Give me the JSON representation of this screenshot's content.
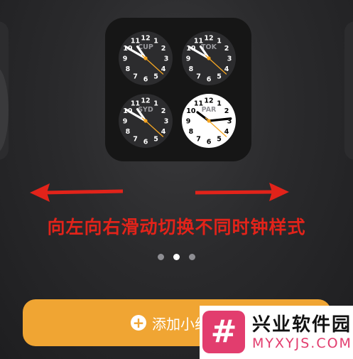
{
  "clocks": [
    {
      "city": "CUP",
      "theme": "dark",
      "hour": 10,
      "minute": 50,
      "second": 22
    },
    {
      "city": "TOK",
      "theme": "dark",
      "hour": 10,
      "minute": 50,
      "second": 22
    },
    {
      "city": "SYD",
      "theme": "dark",
      "hour": 10,
      "minute": 50,
      "second": 22
    },
    {
      "city": "PAR",
      "theme": "light",
      "hour": 10,
      "minute": 14,
      "second": 22
    }
  ],
  "clock_numbers": [
    "12",
    "1",
    "2",
    "3",
    "4",
    "5",
    "6",
    "7",
    "8",
    "9",
    "10",
    "11"
  ],
  "caption": "向左向右滑动切换不同时钟样式",
  "page_dots": {
    "count": 3,
    "active_index": 1
  },
  "add_button": {
    "label": "添加小组件"
  },
  "watermark": {
    "title": "兴业软件园",
    "url": "MYXYJS.COM",
    "logo": "#"
  },
  "colors": {
    "accent": "#f0a533",
    "arrow_red": "#e2231a",
    "second_hand": "#f5a623",
    "watermark_pink": "#e23d6e"
  }
}
